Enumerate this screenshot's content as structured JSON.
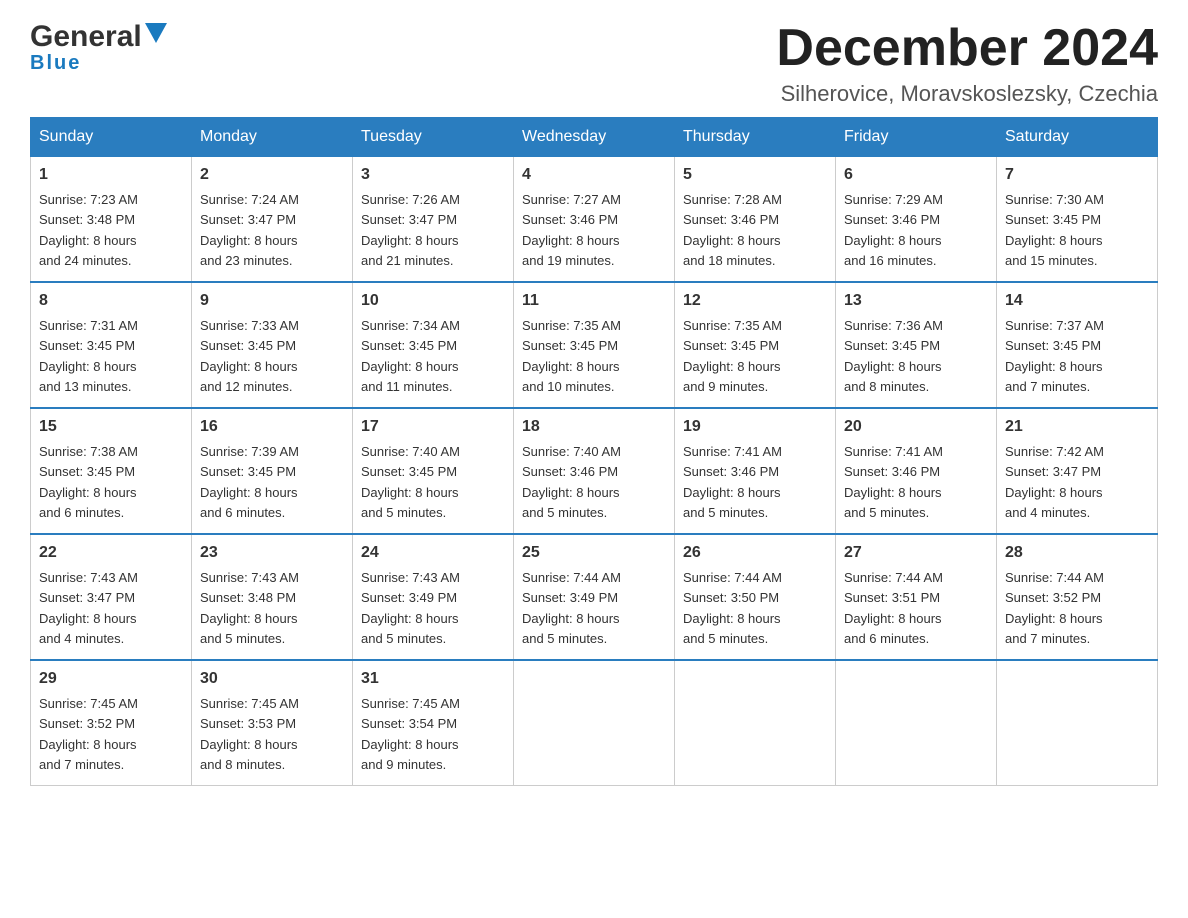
{
  "header": {
    "logo_general": "General",
    "logo_blue": "Blue",
    "calendar_title": "December 2024",
    "calendar_subtitle": "Silherovice, Moravskoslezsky, Czechia"
  },
  "weekdays": [
    "Sunday",
    "Monday",
    "Tuesday",
    "Wednesday",
    "Thursday",
    "Friday",
    "Saturday"
  ],
  "weeks": [
    [
      {
        "day": "1",
        "sunrise": "7:23 AM",
        "sunset": "3:48 PM",
        "daylight": "8 hours and 24 minutes."
      },
      {
        "day": "2",
        "sunrise": "7:24 AM",
        "sunset": "3:47 PM",
        "daylight": "8 hours and 23 minutes."
      },
      {
        "day": "3",
        "sunrise": "7:26 AM",
        "sunset": "3:47 PM",
        "daylight": "8 hours and 21 minutes."
      },
      {
        "day": "4",
        "sunrise": "7:27 AM",
        "sunset": "3:46 PM",
        "daylight": "8 hours and 19 minutes."
      },
      {
        "day": "5",
        "sunrise": "7:28 AM",
        "sunset": "3:46 PM",
        "daylight": "8 hours and 18 minutes."
      },
      {
        "day": "6",
        "sunrise": "7:29 AM",
        "sunset": "3:46 PM",
        "daylight": "8 hours and 16 minutes."
      },
      {
        "day": "7",
        "sunrise": "7:30 AM",
        "sunset": "3:45 PM",
        "daylight": "8 hours and 15 minutes."
      }
    ],
    [
      {
        "day": "8",
        "sunrise": "7:31 AM",
        "sunset": "3:45 PM",
        "daylight": "8 hours and 13 minutes."
      },
      {
        "day": "9",
        "sunrise": "7:33 AM",
        "sunset": "3:45 PM",
        "daylight": "8 hours and 12 minutes."
      },
      {
        "day": "10",
        "sunrise": "7:34 AM",
        "sunset": "3:45 PM",
        "daylight": "8 hours and 11 minutes."
      },
      {
        "day": "11",
        "sunrise": "7:35 AM",
        "sunset": "3:45 PM",
        "daylight": "8 hours and 10 minutes."
      },
      {
        "day": "12",
        "sunrise": "7:35 AM",
        "sunset": "3:45 PM",
        "daylight": "8 hours and 9 minutes."
      },
      {
        "day": "13",
        "sunrise": "7:36 AM",
        "sunset": "3:45 PM",
        "daylight": "8 hours and 8 minutes."
      },
      {
        "day": "14",
        "sunrise": "7:37 AM",
        "sunset": "3:45 PM",
        "daylight": "8 hours and 7 minutes."
      }
    ],
    [
      {
        "day": "15",
        "sunrise": "7:38 AM",
        "sunset": "3:45 PM",
        "daylight": "8 hours and 6 minutes."
      },
      {
        "day": "16",
        "sunrise": "7:39 AM",
        "sunset": "3:45 PM",
        "daylight": "8 hours and 6 minutes."
      },
      {
        "day": "17",
        "sunrise": "7:40 AM",
        "sunset": "3:45 PM",
        "daylight": "8 hours and 5 minutes."
      },
      {
        "day": "18",
        "sunrise": "7:40 AM",
        "sunset": "3:46 PM",
        "daylight": "8 hours and 5 minutes."
      },
      {
        "day": "19",
        "sunrise": "7:41 AM",
        "sunset": "3:46 PM",
        "daylight": "8 hours and 5 minutes."
      },
      {
        "day": "20",
        "sunrise": "7:41 AM",
        "sunset": "3:46 PM",
        "daylight": "8 hours and 5 minutes."
      },
      {
        "day": "21",
        "sunrise": "7:42 AM",
        "sunset": "3:47 PM",
        "daylight": "8 hours and 4 minutes."
      }
    ],
    [
      {
        "day": "22",
        "sunrise": "7:43 AM",
        "sunset": "3:47 PM",
        "daylight": "8 hours and 4 minutes."
      },
      {
        "day": "23",
        "sunrise": "7:43 AM",
        "sunset": "3:48 PM",
        "daylight": "8 hours and 5 minutes."
      },
      {
        "day": "24",
        "sunrise": "7:43 AM",
        "sunset": "3:49 PM",
        "daylight": "8 hours and 5 minutes."
      },
      {
        "day": "25",
        "sunrise": "7:44 AM",
        "sunset": "3:49 PM",
        "daylight": "8 hours and 5 minutes."
      },
      {
        "day": "26",
        "sunrise": "7:44 AM",
        "sunset": "3:50 PM",
        "daylight": "8 hours and 5 minutes."
      },
      {
        "day": "27",
        "sunrise": "7:44 AM",
        "sunset": "3:51 PM",
        "daylight": "8 hours and 6 minutes."
      },
      {
        "day": "28",
        "sunrise": "7:44 AM",
        "sunset": "3:52 PM",
        "daylight": "8 hours and 7 minutes."
      }
    ],
    [
      {
        "day": "29",
        "sunrise": "7:45 AM",
        "sunset": "3:52 PM",
        "daylight": "8 hours and 7 minutes."
      },
      {
        "day": "30",
        "sunrise": "7:45 AM",
        "sunset": "3:53 PM",
        "daylight": "8 hours and 8 minutes."
      },
      {
        "day": "31",
        "sunrise": "7:45 AM",
        "sunset": "3:54 PM",
        "daylight": "8 hours and 9 minutes."
      },
      null,
      null,
      null,
      null
    ]
  ],
  "labels": {
    "sunrise": "Sunrise:",
    "sunset": "Sunset:",
    "daylight": "Daylight:"
  }
}
